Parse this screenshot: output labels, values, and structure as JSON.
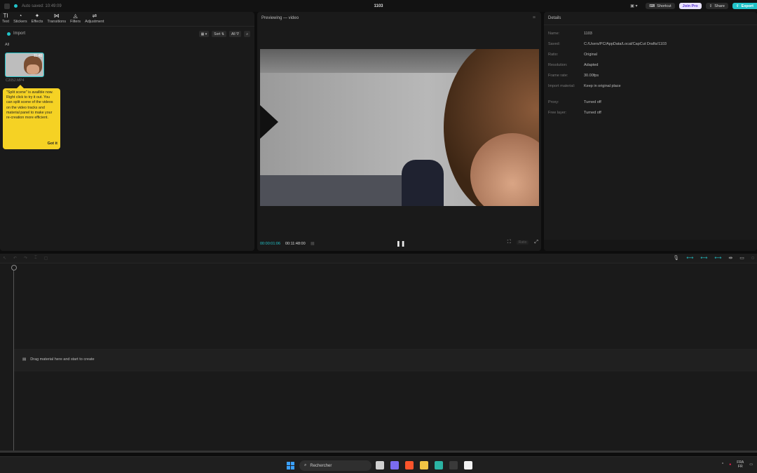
{
  "titlebar": {
    "autosave": "Auto saved: 10:49:09",
    "project_title": "1103",
    "shortcut_label": "Shortcut",
    "joinpro_label": "Join Pro",
    "share_label": "Share",
    "export_label": "Export"
  },
  "media": {
    "tools": [
      {
        "icon": "text-icon",
        "glyph": "TI",
        "label": "Text"
      },
      {
        "icon": "stickers-icon",
        "glyph": "◔",
        "label": "Stickers"
      },
      {
        "icon": "effects-icon",
        "glyph": "✦",
        "label": "Effects"
      },
      {
        "icon": "transitions-icon",
        "glyph": "⋈",
        "label": "Transitions"
      },
      {
        "icon": "filters-icon",
        "glyph": "◬",
        "label": "Filters"
      },
      {
        "icon": "adjustment-icon",
        "glyph": "⇌",
        "label": "Adjustment"
      }
    ],
    "import_label": "Import",
    "sort_label": "Sort",
    "filter_label": "All",
    "all_label": "All",
    "clip": {
      "duration": "11:48",
      "name": "C2052.MP4"
    },
    "tooltip": {
      "text": "\"Split scene\" is availble now. Right click to try it out. You can split scene of the videos on the video tracks and material panel to make your re-creation more efficient.",
      "button": "Got it"
    }
  },
  "preview": {
    "title": "Previewing — video",
    "current_time": "00:00:01:06",
    "total_time": "00:11:48:00",
    "ratio_label": "Ratio"
  },
  "details": {
    "title": "Details",
    "rows": [
      {
        "label": "Name:",
        "value": "1103"
      },
      {
        "label": "Saved:",
        "value": "C:/Users/PC/AppData/Local/CapCut Drafts/1103"
      },
      {
        "label": "Ratio:",
        "value": "Original"
      },
      {
        "label": "Resolution:",
        "value": "Adapted"
      },
      {
        "label": "Frame rate:",
        "value": "30.00fps"
      },
      {
        "label": "Import material:",
        "value": "Keep in original place"
      },
      {
        "label": "Proxy:",
        "value": "Turned off"
      },
      {
        "label": "Free layer:",
        "value": "Turned off"
      }
    ]
  },
  "timeline": {
    "hint": "Drag material here and start to create"
  },
  "taskbar": {
    "search_placeholder": "Rechercher",
    "lang_top": "FRA",
    "lang_bottom": "FR",
    "apps": [
      {
        "name": "task-view-icon",
        "color": "#d0d0d0"
      },
      {
        "name": "chat-icon",
        "color": "#7b6cf2"
      },
      {
        "name": "brave-icon",
        "color": "#fb542b"
      },
      {
        "name": "file-explorer-icon",
        "color": "#f2c544"
      },
      {
        "name": "terminal-icon",
        "color": "#2bb3a3"
      },
      {
        "name": "app-icon",
        "color": "#3a3a3a"
      },
      {
        "name": "capcut-icon",
        "color": "#f2f2f2"
      }
    ]
  }
}
